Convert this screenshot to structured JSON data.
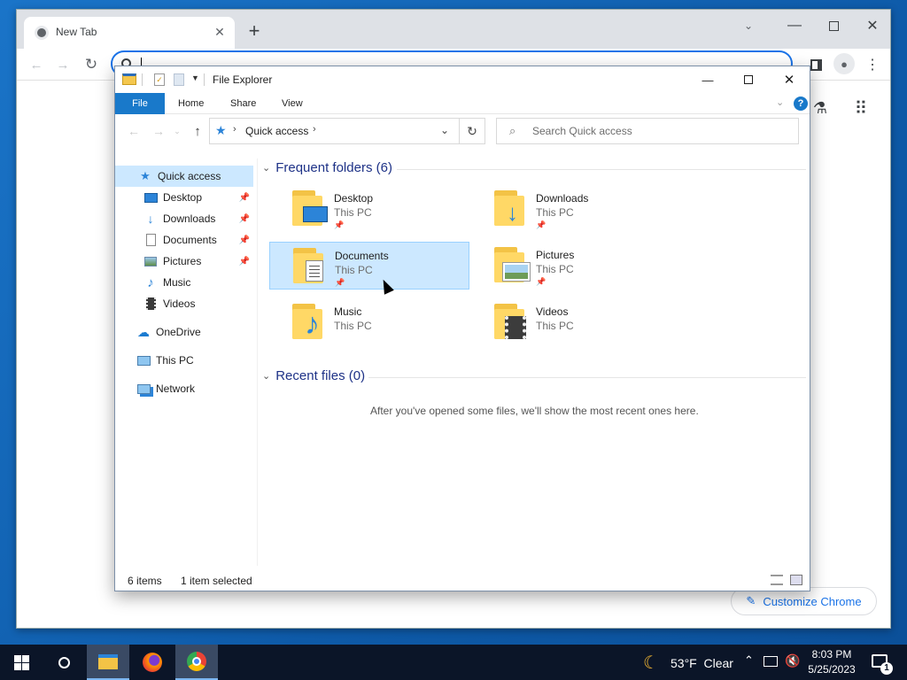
{
  "chrome": {
    "tab_title": "New Tab",
    "customize_label": "Customize Chrome"
  },
  "explorer": {
    "title": "File Explorer",
    "ribbon_tabs": [
      "File",
      "Home",
      "Share",
      "View"
    ],
    "address": "Quick access",
    "search_placeholder": "Search Quick access",
    "nav": {
      "quick_access": "Quick access",
      "items": [
        "Desktop",
        "Downloads",
        "Documents",
        "Pictures",
        "Music",
        "Videos"
      ],
      "onedrive": "OneDrive",
      "this_pc": "This PC",
      "network": "Network"
    },
    "frequent_header": "Frequent folders (6)",
    "folders": [
      {
        "name": "Desktop",
        "location": "This PC",
        "pinned": true
      },
      {
        "name": "Downloads",
        "location": "This PC",
        "pinned": true
      },
      {
        "name": "Documents",
        "location": "This PC",
        "pinned": true
      },
      {
        "name": "Pictures",
        "location": "This PC",
        "pinned": true
      },
      {
        "name": "Music",
        "location": "This PC",
        "pinned": false
      },
      {
        "name": "Videos",
        "location": "This PC",
        "pinned": false
      }
    ],
    "selected_folder": "Documents",
    "recent_header": "Recent files (0)",
    "recent_empty_message": "After you've opened some files, we'll show the most recent ones here.",
    "status": {
      "item_count": "6 items",
      "selection": "1 item selected"
    }
  },
  "taskbar": {
    "weather": "53°F  Clear",
    "time": "8:03 PM",
    "date": "5/25/2023",
    "notification_count": "1"
  },
  "colors": {
    "ribbon_file": "#1979ca",
    "selection": "#cce8ff",
    "section_header": "#1e3287",
    "taskbar": "#0b1528",
    "chrome_accent": "#1a73e8"
  }
}
